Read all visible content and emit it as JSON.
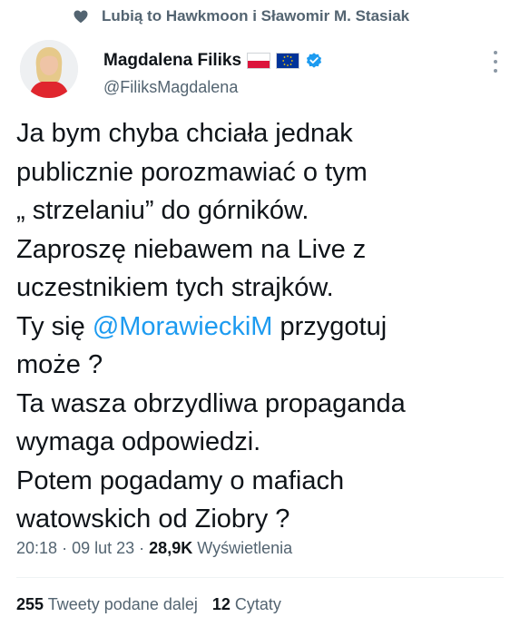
{
  "social_context": {
    "icon": "heart-icon",
    "text": "Lubią to Hawkmoon i Sławomir M. Stasiak"
  },
  "author": {
    "display_name": "Magdalena Filiks",
    "handle": "@FiliksMagdalena",
    "flags": [
      "flag-poland-icon",
      "flag-eu-icon"
    ],
    "verified_icon": "verified-badge-icon",
    "verified_color": "#1d9bf0"
  },
  "tweet": {
    "line1": "Ja bym chyba chciała jednak",
    "line2": "publicznie porozmawiać o tym",
    "line3": "„ strzelaniu” do górników.",
    "line4": "Zaproszę niebawem na Live z",
    "line5": "uczestnikiem tych strajków.",
    "line6_before": "Ty się ",
    "line6_mention": "@MorawieckiM",
    "line6_after": " przygotuj",
    "line7": "może ?",
    "line8": "Ta wasza obrzydliwa propaganda",
    "line9": "wymaga odpowiedzi.",
    "line10": "Potem pogadamy o mafiach",
    "line11": "watowskich od Ziobry ?"
  },
  "meta": {
    "time": "20:18",
    "separator": "·",
    "date": "09 lut 23",
    "views_count": "28,9K",
    "views_label": "Wyświetlenia"
  },
  "stats": {
    "retweets_count": "255",
    "retweets_label": "Tweety podane dalej",
    "quotes_count": "12",
    "quotes_label": "Cytaty"
  },
  "colors": {
    "text": "#0f1419",
    "secondary": "#536471",
    "accent": "#1d9bf0"
  }
}
